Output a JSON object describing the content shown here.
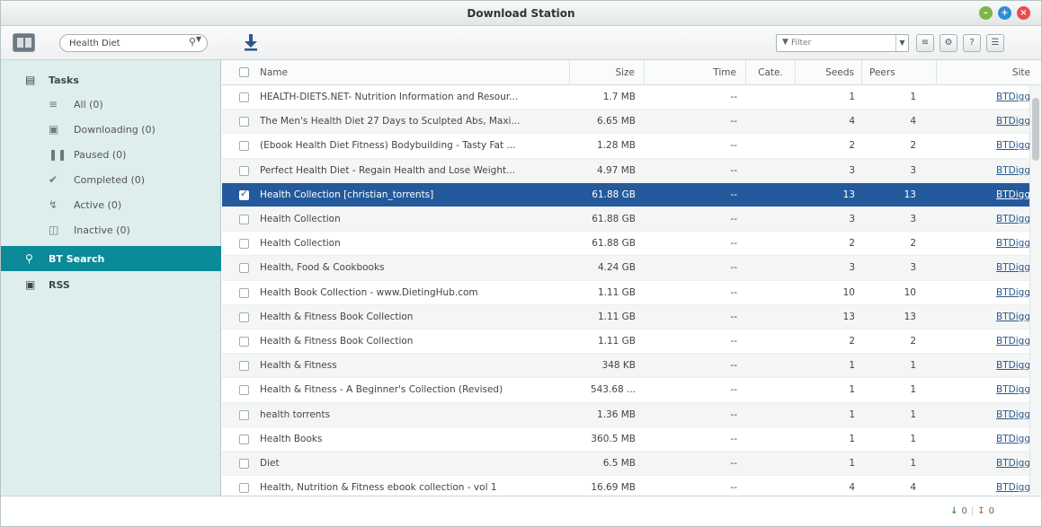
{
  "window": {
    "title": "Download Station"
  },
  "toolbar": {
    "search_value": "Health Diet",
    "filter_placeholder": "Filter"
  },
  "sidebar": {
    "tasks_label": "Tasks",
    "items": [
      {
        "label": "All (0)",
        "icon": "all-icon"
      },
      {
        "label": "Downloading (0)",
        "icon": "downloading-icon"
      },
      {
        "label": "Paused (0)",
        "icon": "pause-icon"
      },
      {
        "label": "Completed (0)",
        "icon": "check-icon"
      },
      {
        "label": "Active (0)",
        "icon": "active-icon"
      },
      {
        "label": "Inactive (0)",
        "icon": "lock-icon"
      }
    ],
    "bt_search_label": "BT Search",
    "rss_label": "RSS"
  },
  "table": {
    "columns": [
      "Name",
      "Size",
      "Time",
      "Cate.",
      "Seeds",
      "Peers",
      "Site"
    ],
    "rows": [
      {
        "name": "HEALTH-DIETS.NET- Nutrition Information and Resour...",
        "size": "1.7 MB",
        "time": "--",
        "cate": "",
        "seeds": "1",
        "peers": "1",
        "site": "BTDigg"
      },
      {
        "name": "The Men's Health Diet 27 Days to Sculpted Abs, Maxi...",
        "size": "6.65 MB",
        "time": "--",
        "cate": "",
        "seeds": "4",
        "peers": "4",
        "site": "BTDigg"
      },
      {
        "name": "(Ebook Health Diet Fitness) Bodybuilding - Tasty Fat ...",
        "size": "1.28 MB",
        "time": "--",
        "cate": "",
        "seeds": "2",
        "peers": "2",
        "site": "BTDigg"
      },
      {
        "name": "Perfect Health Diet - Regain Health and Lose Weight...",
        "size": "4.97 MB",
        "time": "--",
        "cate": "",
        "seeds": "3",
        "peers": "3",
        "site": "BTDigg"
      },
      {
        "name": "Health Collection [christian_torrents]",
        "size": "61.88 GB",
        "time": "--",
        "cate": "",
        "seeds": "13",
        "peers": "13",
        "site": "BTDigg",
        "selected": true
      },
      {
        "name": "Health Collection",
        "size": "61.88 GB",
        "time": "--",
        "cate": "",
        "seeds": "3",
        "peers": "3",
        "site": "BTDigg"
      },
      {
        "name": "Health Collection",
        "size": "61.88 GB",
        "time": "--",
        "cate": "",
        "seeds": "2",
        "peers": "2",
        "site": "BTDigg"
      },
      {
        "name": "Health, Food & Cookbooks",
        "size": "4.24 GB",
        "time": "--",
        "cate": "",
        "seeds": "3",
        "peers": "3",
        "site": "BTDigg"
      },
      {
        "name": "Health Book Collection - www.DietingHub.com",
        "size": "1.11 GB",
        "time": "--",
        "cate": "",
        "seeds": "10",
        "peers": "10",
        "site": "BTDigg"
      },
      {
        "name": "Health & Fitness Book Collection",
        "size": "1.11 GB",
        "time": "--",
        "cate": "",
        "seeds": "13",
        "peers": "13",
        "site": "BTDigg"
      },
      {
        "name": "Health & Fitness Book Collection",
        "size": "1.11 GB",
        "time": "--",
        "cate": "",
        "seeds": "2",
        "peers": "2",
        "site": "BTDigg"
      },
      {
        "name": "Health & Fitness",
        "size": "348 KB",
        "time": "--",
        "cate": "",
        "seeds": "1",
        "peers": "1",
        "site": "BTDigg"
      },
      {
        "name": "Health & Fitness - A Beginner's Collection (Revised)",
        "size": "543.68 ...",
        "time": "--",
        "cate": "",
        "seeds": "1",
        "peers": "1",
        "site": "BTDigg"
      },
      {
        "name": "health torrents",
        "size": "1.36 MB",
        "time": "--",
        "cate": "",
        "seeds": "1",
        "peers": "1",
        "site": "BTDigg"
      },
      {
        "name": "Health Books",
        "size": "360.5 MB",
        "time": "--",
        "cate": "",
        "seeds": "1",
        "peers": "1",
        "site": "BTDigg"
      },
      {
        "name": "Diet",
        "size": "6.5 MB",
        "time": "--",
        "cate": "",
        "seeds": "1",
        "peers": "1",
        "site": "BTDigg"
      },
      {
        "name": "Health, Nutrition & Fitness ebook collection - vol 1",
        "size": "16.69 MB",
        "time": "--",
        "cate": "",
        "seeds": "4",
        "peers": "4",
        "site": "BTDigg"
      }
    ]
  },
  "status": {
    "upload_count": "0",
    "download_count": "0"
  }
}
